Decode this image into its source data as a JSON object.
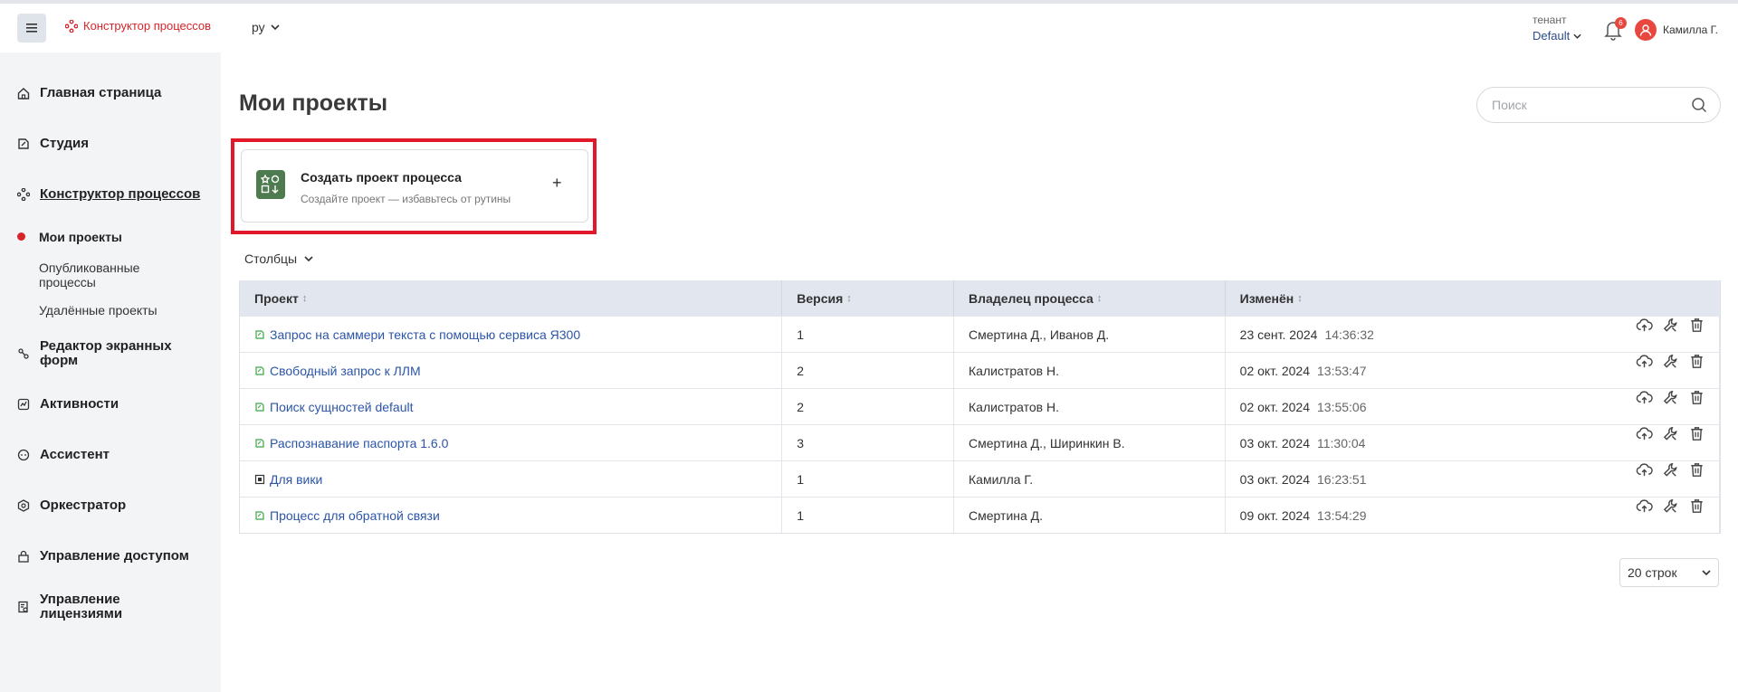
{
  "header": {
    "brand": "Конструктор процессов",
    "language": "ру",
    "tenant_label": "тенант",
    "tenant_value": "Default",
    "notifications_count": "6",
    "user_name": "Камилла Г."
  },
  "sidebar": {
    "items": [
      {
        "label": "Главная страница",
        "icon": "home-icon"
      },
      {
        "label": "Студия",
        "icon": "studio-icon"
      },
      {
        "label": "Конструктор процессов",
        "icon": "process-icon",
        "active": true
      },
      {
        "label": "Редактор экранных форм",
        "icon": "forms-icon"
      },
      {
        "label": "Активности",
        "icon": "activity-icon"
      },
      {
        "label": "Ассистент",
        "icon": "assistant-icon"
      },
      {
        "label": "Оркестратор",
        "icon": "orchestrator-icon"
      },
      {
        "label": "Управление доступом",
        "icon": "lock-icon"
      },
      {
        "label": "Управление лицензиями",
        "icon": "license-icon"
      }
    ],
    "subitems": [
      {
        "label": "Мои проекты",
        "current": true
      },
      {
        "label": "Опубликованные процессы"
      },
      {
        "label": "Удалённые проекты"
      }
    ]
  },
  "main": {
    "title": "Мои проекты",
    "search_placeholder": "Поиск",
    "create_card": {
      "title": "Создать проект процесса",
      "subtitle": "Создайте проект — избавьтесь от рутины",
      "plus": "+"
    },
    "columns_label": "Столбцы",
    "table": {
      "headers": [
        "Проект",
        "Версия",
        "Владелец процесса",
        "Изменён"
      ],
      "rows": [
        {
          "name": "Запрос на саммери текста с помощью сервиса Я300",
          "version": "1",
          "owner": "Смертина Д., Иванов Д.",
          "date": "23 сент. 2024",
          "time": "14:36:32",
          "icon": "process-icon"
        },
        {
          "name": "Свободный запрос к ЛЛМ",
          "version": "2",
          "owner": "Калистратов Н.",
          "date": "02 окт. 2024",
          "time": "13:53:47",
          "icon": "process-icon"
        },
        {
          "name": "Поиск сущностей default",
          "version": "2",
          "owner": "Калистратов Н.",
          "date": "02 окт. 2024",
          "time": "13:55:06",
          "icon": "process-icon"
        },
        {
          "name": "Распознавание паспорта 1.6.0",
          "version": "3",
          "owner": "Смертина Д., Ширинкин В.",
          "date": "03 окт. 2024",
          "time": "11:30:04",
          "icon": "process-icon"
        },
        {
          "name": "Для вики",
          "version": "1",
          "owner": "Камилла Г.",
          "date": "03 окт. 2024",
          "time": "16:23:51",
          "icon": "box-icon"
        },
        {
          "name": "Процесс для обратной связи",
          "version": "1",
          "owner": "Смертина Д.",
          "date": "09 окт. 2024",
          "time": "13:54:29",
          "icon": "process-icon"
        }
      ]
    },
    "rows_per_page": "20 строк"
  },
  "colors": {
    "brand": "#d8232a",
    "link": "#2b55a8",
    "highlight": "#e0182a",
    "create_icon_bg": "#4d7a4e"
  }
}
